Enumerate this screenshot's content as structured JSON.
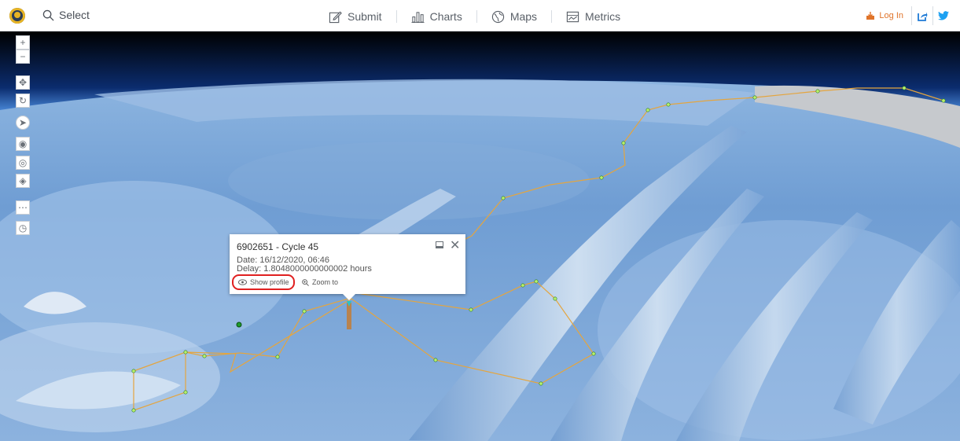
{
  "header": {
    "select_label": "Select",
    "nav": [
      {
        "label": "Submit",
        "icon": "edit-icon"
      },
      {
        "label": "Charts",
        "icon": "bar-chart-icon"
      },
      {
        "label": "Maps",
        "icon": "globe-icon"
      },
      {
        "label": "Metrics",
        "icon": "metrics-icon"
      }
    ],
    "login_label": "Log In",
    "colors": {
      "accent": "#e0742a",
      "share": "#1e7ad6",
      "twitter": "#1da1f2"
    }
  },
  "map_toolbar": {
    "zoom_in": "+",
    "zoom_out": "−",
    "buttons": [
      "pan-icon",
      "rotate-icon",
      "compass-icon",
      "eye-icon",
      "daylight-icon",
      "layers-icon",
      "more-icon",
      "clock-icon"
    ]
  },
  "popup": {
    "title": "6902651 - Cycle 45",
    "date": "Date: 16/12/2020, 06:46",
    "delay": "Delay: 1.8048000000000002 hours",
    "show_profile": "Show profile",
    "zoom_to": "Zoom to"
  }
}
